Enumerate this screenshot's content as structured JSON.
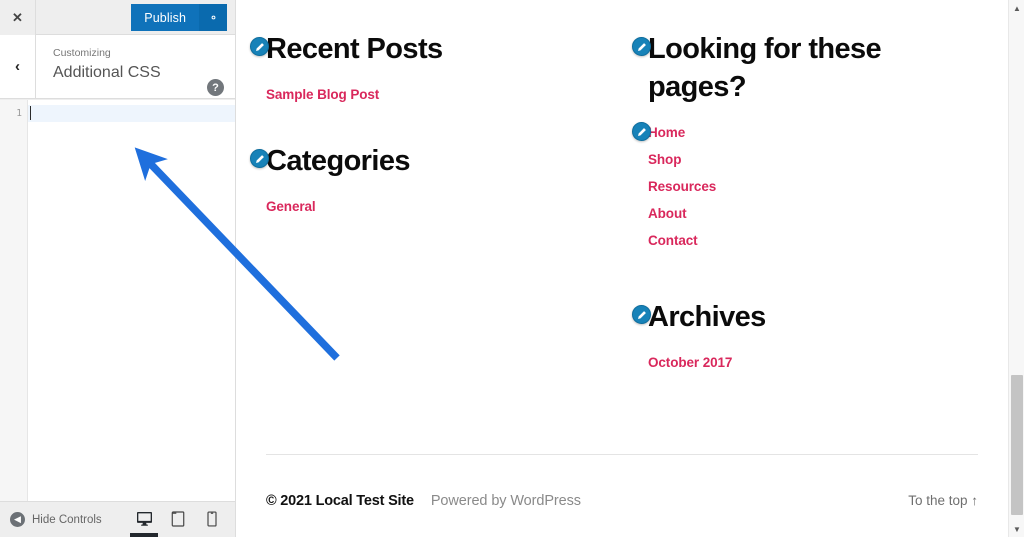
{
  "customizer": {
    "close_label": "✕",
    "close_icon": "close-icon",
    "publish_label": "Publish",
    "gear_icon": "gear-icon",
    "back_label": "‹",
    "back_icon": "chevron-left-icon",
    "breadcrumb_small": "Customizing",
    "breadcrumb_main": "Additional CSS",
    "help_label": "?",
    "help_icon": "help-icon",
    "editor": {
      "line_numbers": [
        "1"
      ],
      "code_lines": [
        ""
      ],
      "active_line": 1
    },
    "bottom": {
      "hide_controls_label": "Hide Controls",
      "collapse_icon": "chevron-left-circle-icon",
      "devices": [
        {
          "name": "desktop",
          "icon": "desktop-icon",
          "active": true
        },
        {
          "name": "tablet",
          "icon": "tablet-icon",
          "active": false
        },
        {
          "name": "mobile",
          "icon": "mobile-icon",
          "active": false
        }
      ]
    }
  },
  "preview": {
    "widgets": [
      {
        "id": "recent-posts",
        "title": "Recent Posts",
        "edit_icon": "pencil-edit-icon",
        "links": [
          "Sample Blog Post"
        ]
      },
      {
        "id": "categories",
        "title": "Categories",
        "edit_icon": "pencil-edit-icon",
        "links": [
          "General"
        ]
      },
      {
        "id": "looking-for-these-pages",
        "title": "Looking for these pages?",
        "edit_icon": "pencil-edit-icon",
        "links": [
          "Home",
          "Shop",
          "Resources",
          "About",
          "Contact"
        ]
      },
      {
        "id": "archives",
        "title": "Archives",
        "edit_icon": "pencil-edit-icon",
        "links": [
          "October 2017"
        ]
      }
    ],
    "footer": {
      "copyright": "© 2021 Local Test Site",
      "powered_by": "Powered by WordPress",
      "to_top": "To the top ↑"
    }
  },
  "scrollbar": {
    "up_icon": "chevron-up-icon",
    "down_icon": "chevron-down-icon",
    "up_label": "▲",
    "down_label": "▼"
  },
  "annotation": {
    "type": "arrow",
    "color": "#1f6fdd",
    "points_at": "additional-css-editor"
  },
  "colors": {
    "wp_blue": "#0f72ba",
    "link_crimson": "#d9285c",
    "edit_pin_blue": "#1782b8",
    "arrow_blue": "#1f6fdd",
    "sidebar_bg": "#eeeeee"
  }
}
